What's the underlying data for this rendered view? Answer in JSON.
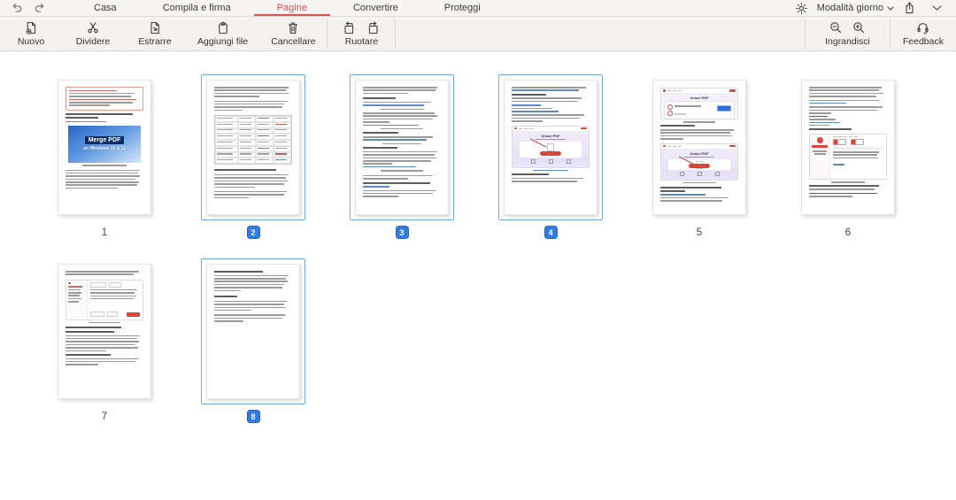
{
  "titlebar": {
    "tabs": [
      {
        "label": "Casa",
        "active": false
      },
      {
        "label": "Compila e firma",
        "active": false
      },
      {
        "label": "Pagine",
        "active": true
      },
      {
        "label": "Convertire",
        "active": false
      },
      {
        "label": "Proteggi",
        "active": false
      }
    ],
    "mode_label": "Modalità giorno"
  },
  "toolbar": {
    "buttons": [
      {
        "label": "Nuovo"
      },
      {
        "label": "Dividere"
      },
      {
        "label": "Estrarre"
      },
      {
        "label": "Aggiungi file"
      },
      {
        "label": "Cancellare"
      }
    ],
    "rotate_label": "Ruotare",
    "zoom_label": "Ingrandisci",
    "feedback_label": "Feedback"
  },
  "colors": {
    "accent_red": "#d9534f",
    "selection_blue": "#6ea6e8",
    "badge_blue": "#2f7de1"
  },
  "pages": [
    {
      "num": "1",
      "selected": false,
      "kind": "cover",
      "banner_title": "Merge PDF",
      "banner_subtitle": "on Windows 10 & 11"
    },
    {
      "num": "2",
      "selected": true,
      "kind": "table"
    },
    {
      "num": "3",
      "selected": true,
      "kind": "text"
    },
    {
      "num": "4",
      "selected": true,
      "kind": "shot_purple",
      "screenshot_title": "Unisci PDF"
    },
    {
      "num": "5",
      "selected": false,
      "kind": "two_shots",
      "screenshot_title": "Unisci PDF"
    },
    {
      "num": "6",
      "selected": false,
      "kind": "app_shot"
    },
    {
      "num": "7",
      "selected": false,
      "kind": "app_shot2"
    },
    {
      "num": "8",
      "selected": true,
      "kind": "text_short"
    }
  ]
}
